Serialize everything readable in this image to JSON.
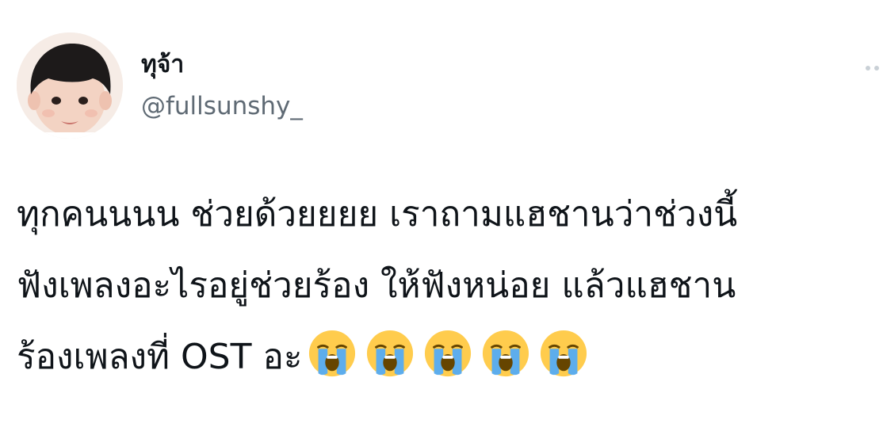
{
  "user": {
    "display_name": "ทุจ้า",
    "handle": "@fullsunshy_"
  },
  "tweet": {
    "line1": "ทุกคนนนน ช่วยด้วยยยย เราถามแฮชานว่าช่วงนี้",
    "line2": "ฟังเพลงอะไรอยู่ช่วยร้อง ให้ฟังหน่อย แล้วแฮชาน",
    "line3": "ร้องเพลงที่ OST อะ",
    "emojis": [
      "loudly-crying-face",
      "loudly-crying-face",
      "loudly-crying-face",
      "loudly-crying-face",
      "loudly-crying-face"
    ]
  },
  "colors": {
    "text": "#0f1419",
    "handle": "#5f6a74",
    "emoji_face": "#ffcc4d",
    "emoji_tears": "#5dadec"
  },
  "icons": {
    "more": "more-options-icon",
    "crying": "loudly-crying-face-emoji"
  }
}
